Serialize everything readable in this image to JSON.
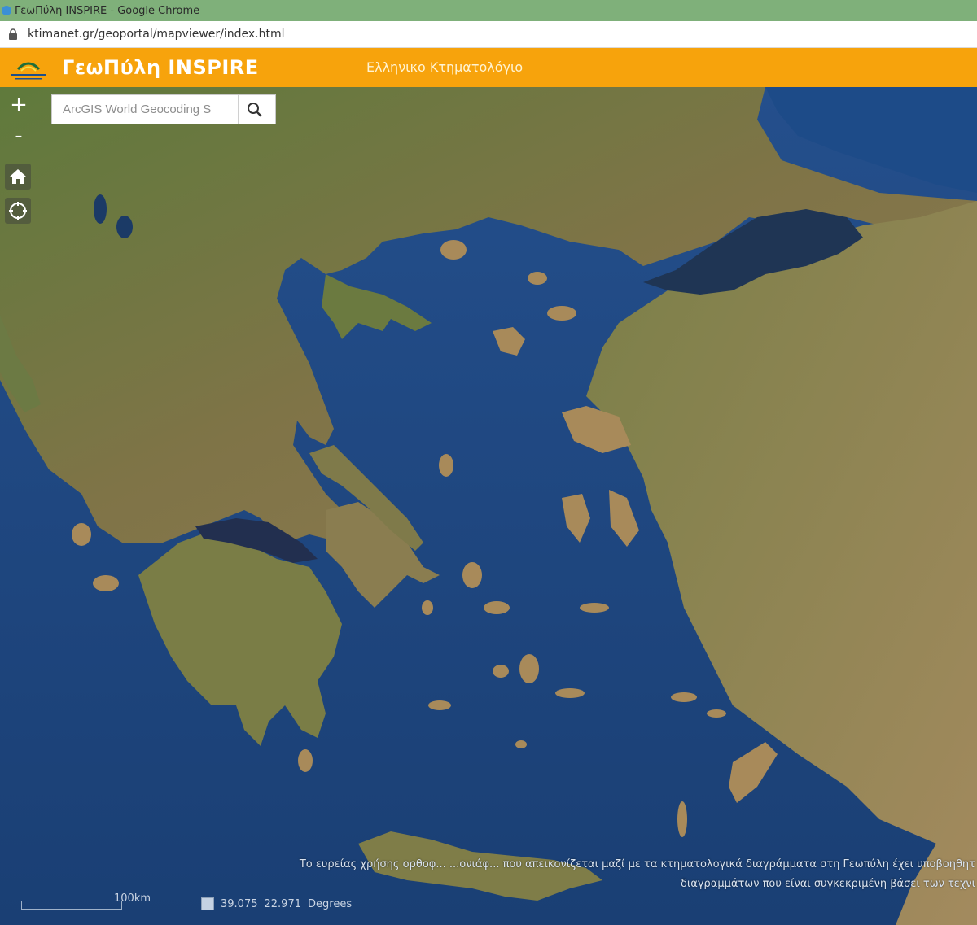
{
  "browser": {
    "window_title": "ΓεωΠύλη INSPIRE - Google Chrome",
    "url": "ktimanet.gr/geoportal/mapviewer/index.html"
  },
  "header": {
    "title": "ΓεωΠύλη INSPIRE",
    "subtitle": "Ελληνικο Κτηματολόγιο",
    "brand_color": "#f7a30c"
  },
  "map": {
    "controls": {
      "zoom_in": "+",
      "zoom_out": "-",
      "home_icon": "home-icon",
      "locate_icon": "locate-icon"
    },
    "search": {
      "placeholder": "ArcGIS World Geocoding S",
      "button_icon": "search-icon"
    },
    "attribution": {
      "line1": "Το ευρείας χρήσης ορθοφ... ...ονιάφ... που απεικονίζεται μαζί με τα κτηματολογικά διαγράμματα στη Γεωπύλη έχει υποβοηθητ",
      "line2": "διαγραμμάτων που είναι συγκεκριμένη βάσει των τεχνι"
    },
    "scale": {
      "label": "100km"
    },
    "coordinates": {
      "lat": "39.075",
      "lon": "22.971",
      "unit": "Degrees"
    }
  }
}
